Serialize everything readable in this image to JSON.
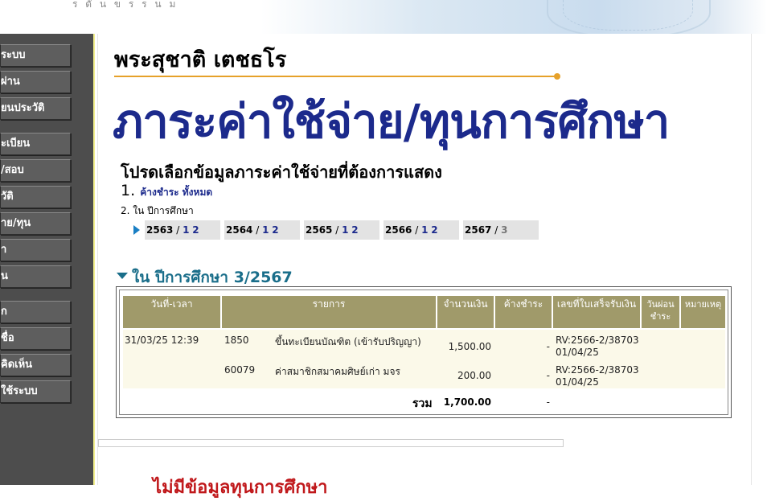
{
  "top_fragment": "ร ดั น ข ร ร น ม",
  "sidebar": {
    "items": [
      {
        "label": "ระบบ"
      },
      {
        "label": "ผ่าน"
      },
      {
        "label": "ยนประวัติ"
      },
      {
        "label": "ะเบียน"
      },
      {
        "label": "/สอบ"
      },
      {
        "label": "วัติ"
      },
      {
        "label": "าย/ทุน"
      },
      {
        "label": "า"
      },
      {
        "label": "น"
      },
      {
        "label": "ก"
      },
      {
        "label": "ชื่อ"
      },
      {
        "label": "คิดเห็น"
      },
      {
        "label": "ใช้ระบบ"
      }
    ]
  },
  "student_name": "พระสุชาติ เตชธโร",
  "page_title": "ภาระค่าใช้จ่าย/ทุนการศึกษา",
  "subtitle": "โปรดเลือกข้อมูลภาระค่าใช้จ่ายที่ต้องการแสดง",
  "option1": {
    "number": "1.",
    "label": "ค้างชำระ ทั้งหมด"
  },
  "option2": {
    "number": "2.",
    "label": "ใน ปีการศึกษา"
  },
  "years": [
    {
      "year": "2563",
      "sep": " / ",
      "sem1": "1",
      "sem2": "2"
    },
    {
      "year": "2564",
      "sep": " / ",
      "sem1": "1",
      "sem2": "2"
    },
    {
      "year": "2565",
      "sep": " / ",
      "sem1": "1",
      "sem2": "2"
    },
    {
      "year": "2566",
      "sep": " / ",
      "sem1": "1",
      "sem2": "2"
    },
    {
      "year": "2567",
      "sep": " / ",
      "sem1": "3",
      "sem2": ""
    }
  ],
  "section_heading": "ใน ปีการศึกษา 3/2567",
  "table": {
    "headers": [
      "วันที่-เวลา",
      "รายการ",
      "จำนวนเงิน",
      "ค้างชำระ",
      "เลขที่ใบเสร็จรับเงิน",
      "วันผ่อนชำระ",
      "หมายเหตุ"
    ],
    "rows": [
      {
        "datetime": "31/03/25 12:39",
        "code": "1850",
        "item": "ขึ้นทะเบียนบัณฑิต (เข้ารับปริญญา)",
        "amount": "1,500.00",
        "outstanding": "-",
        "receipt": "RV:2566-2/38703",
        "receipt_date": "01/04/25"
      },
      {
        "datetime": "",
        "code": "60079",
        "item": "ค่าสมาชิกสมาคมศิษย์เก่า มจร",
        "amount": "200.00",
        "outstanding": "-",
        "receipt": "RV:2566-2/38703",
        "receipt_date": "01/04/25"
      }
    ],
    "total_label": "รวม",
    "total_amount": "1,700.00",
    "total_outstanding": "-"
  },
  "bottom_text": "ไม่มีข้อมูลทุนการศึกษา"
}
